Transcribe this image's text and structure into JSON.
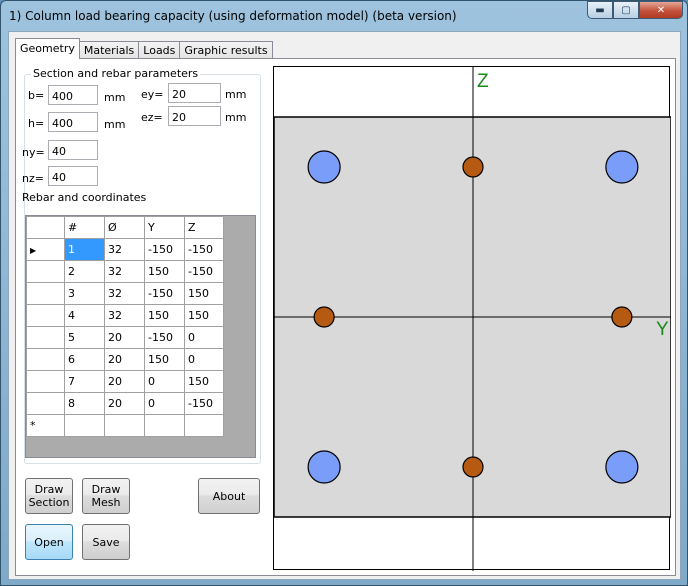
{
  "window": {
    "title": "1) Column load bearing capacity (using deformation model) (beta version)",
    "minimize_glyph": "▬",
    "maximize_glyph": "▢",
    "close_glyph": "✕"
  },
  "tabs": [
    {
      "label": "Geometry",
      "active": true
    },
    {
      "label": "Materials",
      "active": false
    },
    {
      "label": "Loads",
      "active": false
    },
    {
      "label": "Graphic results",
      "active": false
    }
  ],
  "section_group": {
    "title": "Section and rebar parameters",
    "b_label": "b=",
    "b_value": "400",
    "b_unit": "mm",
    "h_label": "h=",
    "h_value": "400",
    "h_unit": "mm",
    "ey_label": "ey=",
    "ey_value": "20",
    "ey_unit": "mm",
    "ez_label": "ez=",
    "ez_value": "20",
    "ez_unit": "mm",
    "ny_label": "ny=",
    "ny_value": "40",
    "nz_label": "nz=",
    "nz_value": "40",
    "rebar_label": "Rebar and coordinates"
  },
  "rebar_table": {
    "columns": [
      "#",
      "Ø",
      "Y",
      "Z"
    ],
    "rows": [
      [
        "1",
        "32",
        "-150",
        "-150"
      ],
      [
        "2",
        "32",
        "150",
        "-150"
      ],
      [
        "3",
        "32",
        "-150",
        "150"
      ],
      [
        "4",
        "32",
        "150",
        "150"
      ],
      [
        "5",
        "20",
        "-150",
        "0"
      ],
      [
        "6",
        "20",
        "150",
        "0"
      ],
      [
        "7",
        "20",
        "0",
        "150"
      ],
      [
        "8",
        "20",
        "0",
        "-150"
      ]
    ],
    "current_row_marker": "▶",
    "new_row_marker": "*"
  },
  "buttons": {
    "draw_section": "Draw Section",
    "draw_mesh": "Draw Mesh",
    "about": "About",
    "open": "Open",
    "save": "Save"
  },
  "drawing": {
    "axis_z_label": "Z",
    "axis_y_label": "Y",
    "axis_color": "#1a8a1a",
    "section_fill": "#d9d9d9",
    "large_bar_color": "#7b9dfa",
    "small_bar_color": "#b65a12",
    "section_b_mm": 400,
    "section_h_mm": 400
  }
}
